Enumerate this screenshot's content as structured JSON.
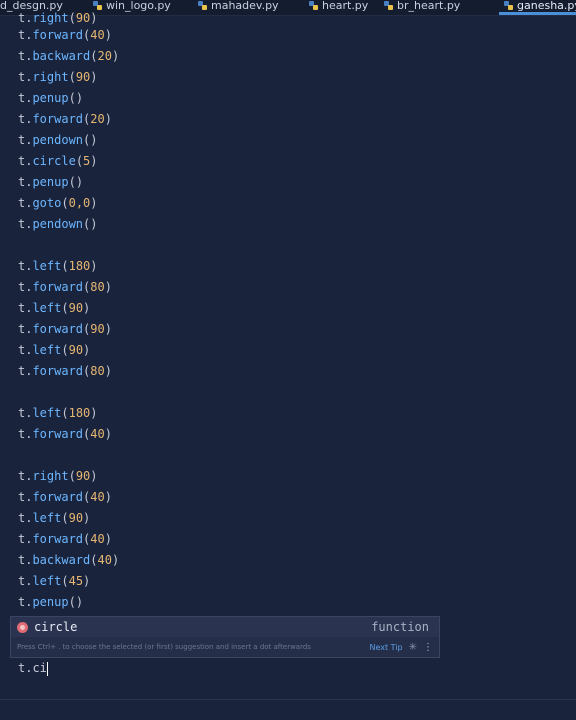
{
  "tabs": [
    {
      "label": "d_desgn.py",
      "active": false
    },
    {
      "label": "win_logo.py",
      "active": false
    },
    {
      "label": "mahadev.py",
      "active": false
    },
    {
      "label": "heart.py",
      "active": false
    },
    {
      "label": "br_heart.py",
      "active": false
    },
    {
      "label": "ganesha.py",
      "active": true
    }
  ],
  "code": {
    "clipped_line": {
      "obj": "t.",
      "fn": "right",
      "arg": "90"
    },
    "lines": [
      {
        "obj": "t.",
        "fn": "forward",
        "arg": "40"
      },
      {
        "obj": "t.",
        "fn": "backward",
        "arg": "20"
      },
      {
        "obj": "t.",
        "fn": "right",
        "arg": "90"
      },
      {
        "obj": "t.",
        "fn": "penup",
        "arg": ""
      },
      {
        "obj": "t.",
        "fn": "forward",
        "arg": "20"
      },
      {
        "obj": "t.",
        "fn": "pendown",
        "arg": ""
      },
      {
        "obj": "t.",
        "fn": "circle",
        "arg": "5"
      },
      {
        "obj": "t.",
        "fn": "penup",
        "arg": ""
      },
      {
        "obj": "t.",
        "fn": "goto",
        "arg": "0,0"
      },
      {
        "obj": "t.",
        "fn": "pendown",
        "arg": ""
      },
      null,
      {
        "obj": "t.",
        "fn": "left",
        "arg": "180"
      },
      {
        "obj": "t.",
        "fn": "forward",
        "arg": "80"
      },
      {
        "obj": "t.",
        "fn": "left",
        "arg": "90"
      },
      {
        "obj": "t.",
        "fn": "forward",
        "arg": "90"
      },
      {
        "obj": "t.",
        "fn": "left",
        "arg": "90"
      },
      {
        "obj": "t.",
        "fn": "forward",
        "arg": "80"
      },
      null,
      {
        "obj": "t.",
        "fn": "left",
        "arg": "180"
      },
      {
        "obj": "t.",
        "fn": "forward",
        "arg": "40"
      },
      null,
      {
        "obj": "t.",
        "fn": "right",
        "arg": "90"
      },
      {
        "obj": "t.",
        "fn": "forward",
        "arg": "40"
      },
      {
        "obj": "t.",
        "fn": "left",
        "arg": "90"
      },
      {
        "obj": "t.",
        "fn": "forward",
        "arg": "40"
      },
      {
        "obj": "t.",
        "fn": "backward",
        "arg": "40"
      },
      {
        "obj": "t.",
        "fn": "left",
        "arg": "45"
      },
      {
        "obj": "t.",
        "fn": "penup",
        "arg": ""
      }
    ],
    "typing_line": "t.ci"
  },
  "autocomplete": {
    "suggestion": "circle",
    "kind": "function",
    "hint": "Press Ctrl+ . to choose the selected (or first) suggestion and insert a dot afterwards",
    "next_tip": "Next Tip",
    "spinner_icon": "spinner-icon",
    "more_icon": "more-vertical-icon"
  },
  "colors": {
    "background": "#19233c",
    "function": "#6cb6ff",
    "number": "#e6b673",
    "tab_accent": "#4a90d9"
  }
}
